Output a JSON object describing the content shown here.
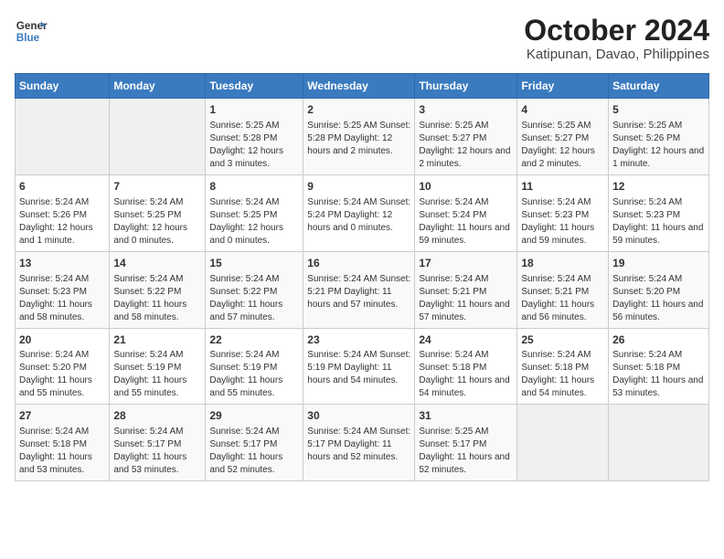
{
  "logo": {
    "line1": "General",
    "line2": "Blue"
  },
  "title": "October 2024",
  "subtitle": "Katipunan, Davao, Philippines",
  "headers": [
    "Sunday",
    "Monday",
    "Tuesday",
    "Wednesday",
    "Thursday",
    "Friday",
    "Saturday"
  ],
  "weeks": [
    [
      {
        "day": "",
        "content": ""
      },
      {
        "day": "",
        "content": ""
      },
      {
        "day": "1",
        "content": "Sunrise: 5:25 AM\nSunset: 5:28 PM\nDaylight: 12 hours and 3 minutes."
      },
      {
        "day": "2",
        "content": "Sunrise: 5:25 AM\nSunset: 5:28 PM\nDaylight: 12 hours and 2 minutes."
      },
      {
        "day": "3",
        "content": "Sunrise: 5:25 AM\nSunset: 5:27 PM\nDaylight: 12 hours and 2 minutes."
      },
      {
        "day": "4",
        "content": "Sunrise: 5:25 AM\nSunset: 5:27 PM\nDaylight: 12 hours and 2 minutes."
      },
      {
        "day": "5",
        "content": "Sunrise: 5:25 AM\nSunset: 5:26 PM\nDaylight: 12 hours and 1 minute."
      }
    ],
    [
      {
        "day": "6",
        "content": "Sunrise: 5:24 AM\nSunset: 5:26 PM\nDaylight: 12 hours and 1 minute."
      },
      {
        "day": "7",
        "content": "Sunrise: 5:24 AM\nSunset: 5:25 PM\nDaylight: 12 hours and 0 minutes."
      },
      {
        "day": "8",
        "content": "Sunrise: 5:24 AM\nSunset: 5:25 PM\nDaylight: 12 hours and 0 minutes."
      },
      {
        "day": "9",
        "content": "Sunrise: 5:24 AM\nSunset: 5:24 PM\nDaylight: 12 hours and 0 minutes."
      },
      {
        "day": "10",
        "content": "Sunrise: 5:24 AM\nSunset: 5:24 PM\nDaylight: 11 hours and 59 minutes."
      },
      {
        "day": "11",
        "content": "Sunrise: 5:24 AM\nSunset: 5:23 PM\nDaylight: 11 hours and 59 minutes."
      },
      {
        "day": "12",
        "content": "Sunrise: 5:24 AM\nSunset: 5:23 PM\nDaylight: 11 hours and 59 minutes."
      }
    ],
    [
      {
        "day": "13",
        "content": "Sunrise: 5:24 AM\nSunset: 5:23 PM\nDaylight: 11 hours and 58 minutes."
      },
      {
        "day": "14",
        "content": "Sunrise: 5:24 AM\nSunset: 5:22 PM\nDaylight: 11 hours and 58 minutes."
      },
      {
        "day": "15",
        "content": "Sunrise: 5:24 AM\nSunset: 5:22 PM\nDaylight: 11 hours and 57 minutes."
      },
      {
        "day": "16",
        "content": "Sunrise: 5:24 AM\nSunset: 5:21 PM\nDaylight: 11 hours and 57 minutes."
      },
      {
        "day": "17",
        "content": "Sunrise: 5:24 AM\nSunset: 5:21 PM\nDaylight: 11 hours and 57 minutes."
      },
      {
        "day": "18",
        "content": "Sunrise: 5:24 AM\nSunset: 5:21 PM\nDaylight: 11 hours and 56 minutes."
      },
      {
        "day": "19",
        "content": "Sunrise: 5:24 AM\nSunset: 5:20 PM\nDaylight: 11 hours and 56 minutes."
      }
    ],
    [
      {
        "day": "20",
        "content": "Sunrise: 5:24 AM\nSunset: 5:20 PM\nDaylight: 11 hours and 55 minutes."
      },
      {
        "day": "21",
        "content": "Sunrise: 5:24 AM\nSunset: 5:19 PM\nDaylight: 11 hours and 55 minutes."
      },
      {
        "day": "22",
        "content": "Sunrise: 5:24 AM\nSunset: 5:19 PM\nDaylight: 11 hours and 55 minutes."
      },
      {
        "day": "23",
        "content": "Sunrise: 5:24 AM\nSunset: 5:19 PM\nDaylight: 11 hours and 54 minutes."
      },
      {
        "day": "24",
        "content": "Sunrise: 5:24 AM\nSunset: 5:18 PM\nDaylight: 11 hours and 54 minutes."
      },
      {
        "day": "25",
        "content": "Sunrise: 5:24 AM\nSunset: 5:18 PM\nDaylight: 11 hours and 54 minutes."
      },
      {
        "day": "26",
        "content": "Sunrise: 5:24 AM\nSunset: 5:18 PM\nDaylight: 11 hours and 53 minutes."
      }
    ],
    [
      {
        "day": "27",
        "content": "Sunrise: 5:24 AM\nSunset: 5:18 PM\nDaylight: 11 hours and 53 minutes."
      },
      {
        "day": "28",
        "content": "Sunrise: 5:24 AM\nSunset: 5:17 PM\nDaylight: 11 hours and 53 minutes."
      },
      {
        "day": "29",
        "content": "Sunrise: 5:24 AM\nSunset: 5:17 PM\nDaylight: 11 hours and 52 minutes."
      },
      {
        "day": "30",
        "content": "Sunrise: 5:24 AM\nSunset: 5:17 PM\nDaylight: 11 hours and 52 minutes."
      },
      {
        "day": "31",
        "content": "Sunrise: 5:25 AM\nSunset: 5:17 PM\nDaylight: 11 hours and 52 minutes."
      },
      {
        "day": "",
        "content": ""
      },
      {
        "day": "",
        "content": ""
      }
    ]
  ]
}
